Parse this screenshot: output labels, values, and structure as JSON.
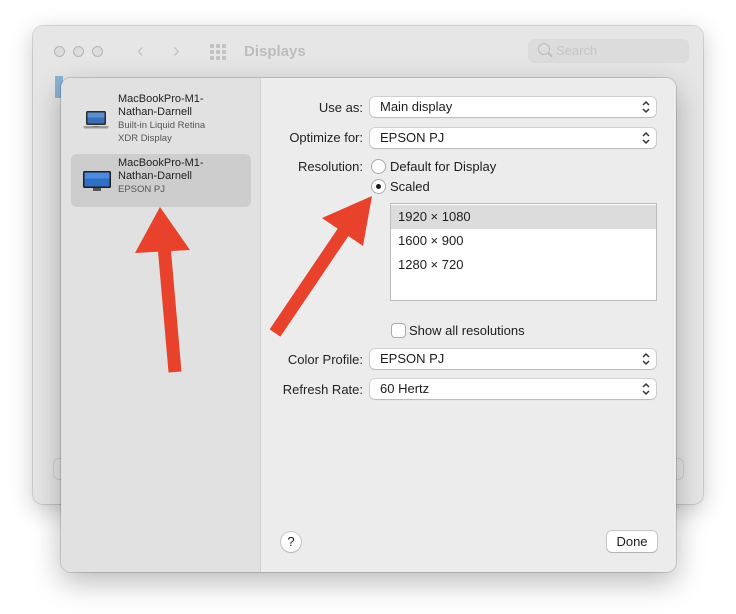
{
  "background_window": {
    "title": "Displays",
    "search_placeholder": "Search"
  },
  "sidebar": {
    "displays": [
      {
        "name_line1": "MacBookPro-M1-",
        "name_line2": "Nathan-Darnell",
        "sub_line1": "Built-in Liquid Retina",
        "sub_line2": "XDR Display",
        "icon": "laptop-icon",
        "selected": false
      },
      {
        "name_line1": "MacBookPro-M1-",
        "name_line2": "Nathan-Darnell",
        "sub_line1": "EPSON PJ",
        "icon": "monitor-icon",
        "selected": true
      }
    ]
  },
  "settings": {
    "use_as": {
      "label": "Use as:",
      "value": "Main display"
    },
    "optimize_for": {
      "label": "Optimize for:",
      "value": "EPSON PJ"
    },
    "resolution": {
      "label": "Resolution:",
      "default_label": "Default for Display",
      "scaled_label": "Scaled",
      "selected": "scaled",
      "options": [
        "1920 × 1080",
        "1600 × 900",
        "1280 × 720"
      ],
      "selected_option": "1920 × 1080"
    },
    "show_all_resolutions": {
      "label": "Show all resolutions",
      "checked": false
    },
    "color_profile": {
      "label": "Color Profile:",
      "value": "EPSON PJ"
    },
    "refresh_rate": {
      "label": "Refresh Rate:",
      "value": "60 Hertz"
    }
  },
  "footer": {
    "help_label": "?",
    "done_label": "Done"
  },
  "annotation_color": "#e8412c"
}
